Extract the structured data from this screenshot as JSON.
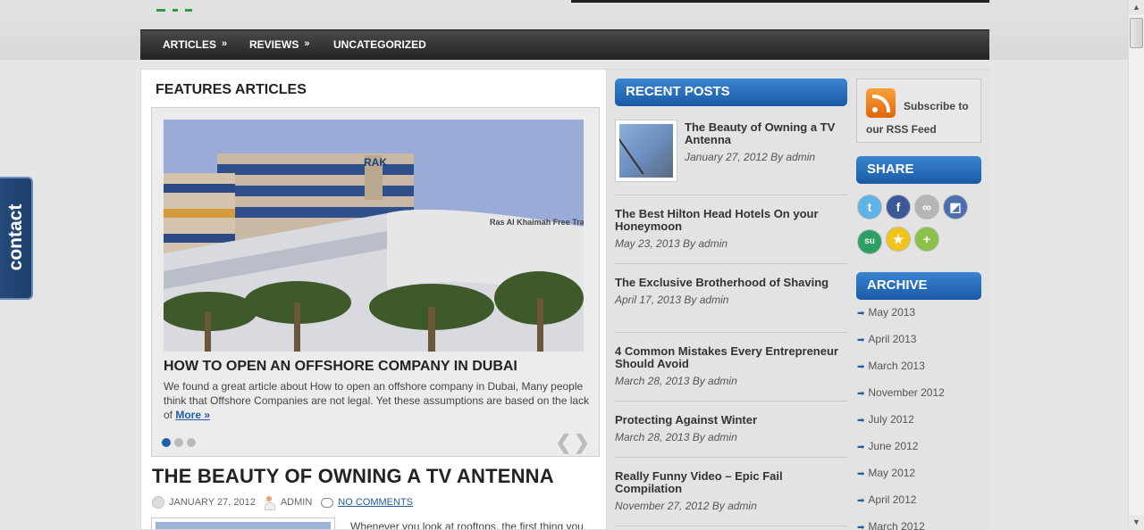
{
  "nav": {
    "items": [
      {
        "label": "ARTICLES",
        "has_submenu": true
      },
      {
        "label": "REVIEWS",
        "has_submenu": true
      },
      {
        "label": "UNCATEGORIZED",
        "has_submenu": false
      }
    ],
    "submenu_glyph": "»"
  },
  "contact_tab": {
    "label": "contact"
  },
  "features": {
    "title": "FEATURES ARTICLES",
    "slide": {
      "title": "HOW TO OPEN AN OFFSHORE COMPANY IN DUBAI",
      "excerpt": "We found a great article about How to open an offshore company in Dubai, Many people think that Offshore Companies are not legal. Yet these assumptions are based on the lack of ",
      "more_label": "More »",
      "image_sign": "Ras Al Khaimah Free Trade Zo",
      "image_logo": "RAK"
    },
    "dots_count": 3,
    "active_dot": 1,
    "prev_glyph": "❮",
    "next_glyph": "❯"
  },
  "post": {
    "title": "THE BEAUTY OF OWNING A TV ANTENNA",
    "date": "JANUARY 27, 2012",
    "author": "ADMIN",
    "comments": "NO COMMENTS",
    "text": "Whenever you look at rooftops, the first thing you"
  },
  "recent_posts": {
    "heading": "RECENT POSTS",
    "items": [
      {
        "title": "The Beauty of Owning a TV Antenna",
        "meta": "January 27, 2012 By admin"
      },
      {
        "title": "The Best Hilton Head Hotels On your Honeymoon",
        "meta": "May 23, 2013 By admin"
      },
      {
        "title": "The Exclusive Brotherhood of Shaving",
        "meta": "April 17, 2013 By admin"
      },
      {
        "title": "4 Common Mistakes Every Entrepreneur Should Avoid",
        "meta": "March 28, 2013 By admin"
      },
      {
        "title": "Protecting Against Winter",
        "meta": "March 28, 2013 By admin"
      },
      {
        "title": "Really Funny Video – Epic Fail Compilation",
        "meta": "November 27, 2012 By admin"
      }
    ]
  },
  "rss": {
    "label": "Subscribe to our RSS Feed",
    "icon": "rss-icon"
  },
  "share": {
    "heading": "SHARE",
    "icons": [
      {
        "name": "twitter-icon",
        "glyph": "t",
        "color": "#5fb3e6"
      },
      {
        "name": "facebook-icon",
        "glyph": "f",
        "color": "#3b5998"
      },
      {
        "name": "myspace-icon",
        "glyph": "∞",
        "color": "#b5b5b5"
      },
      {
        "name": "delicious-icon",
        "glyph": "◩",
        "color": "#4d6fb0"
      },
      {
        "name": "stumbleupon-icon",
        "glyph": "su",
        "color": "#2d9f62"
      },
      {
        "name": "favorite-star-icon",
        "glyph": "★",
        "color": "#f0c419"
      },
      {
        "name": "add-more-icon",
        "glyph": "+",
        "color": "#8bc34a"
      }
    ]
  },
  "archive": {
    "heading": "ARCHIVE",
    "items": [
      "May 2013",
      "April 2013",
      "March 2013",
      "November 2012",
      "July 2012",
      "June 2012",
      "May 2012",
      "April 2012",
      "March 2012"
    ]
  },
  "scrollbar": {
    "up_glyph": "▲",
    "down_glyph": "▼"
  }
}
